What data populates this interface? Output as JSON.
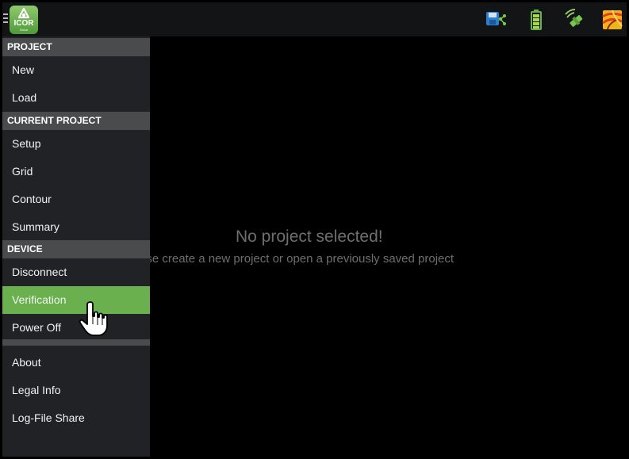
{
  "app": {
    "logo_text": "ICOR",
    "logo_subtext": "Sabat"
  },
  "status_icons": [
    "save-share-icon",
    "battery-icon",
    "satellite-signal-icon",
    "map-layer-icon"
  ],
  "drawer": {
    "sections": [
      {
        "title": "PROJECT",
        "items": [
          "New",
          "Load"
        ]
      },
      {
        "title": "CURRENT PROJECT",
        "items": [
          "Setup",
          "Grid",
          "Contour",
          "Summary"
        ]
      },
      {
        "title": "DEVICE",
        "items": [
          "Disconnect",
          "Verification",
          "Power Off"
        ]
      },
      {
        "title": "",
        "items": [
          "About",
          "Legal Info",
          "Log-File Share"
        ]
      }
    ],
    "active_item": "Verification"
  },
  "main": {
    "empty_title": "No project selected!",
    "empty_subtitle": "ase create a new project or open a previously saved project"
  },
  "colors": {
    "accent": "#6ab04e",
    "section_bg": "#4a4b4d",
    "drawer_bg": "#202225",
    "topbar_bg": "#131416"
  }
}
